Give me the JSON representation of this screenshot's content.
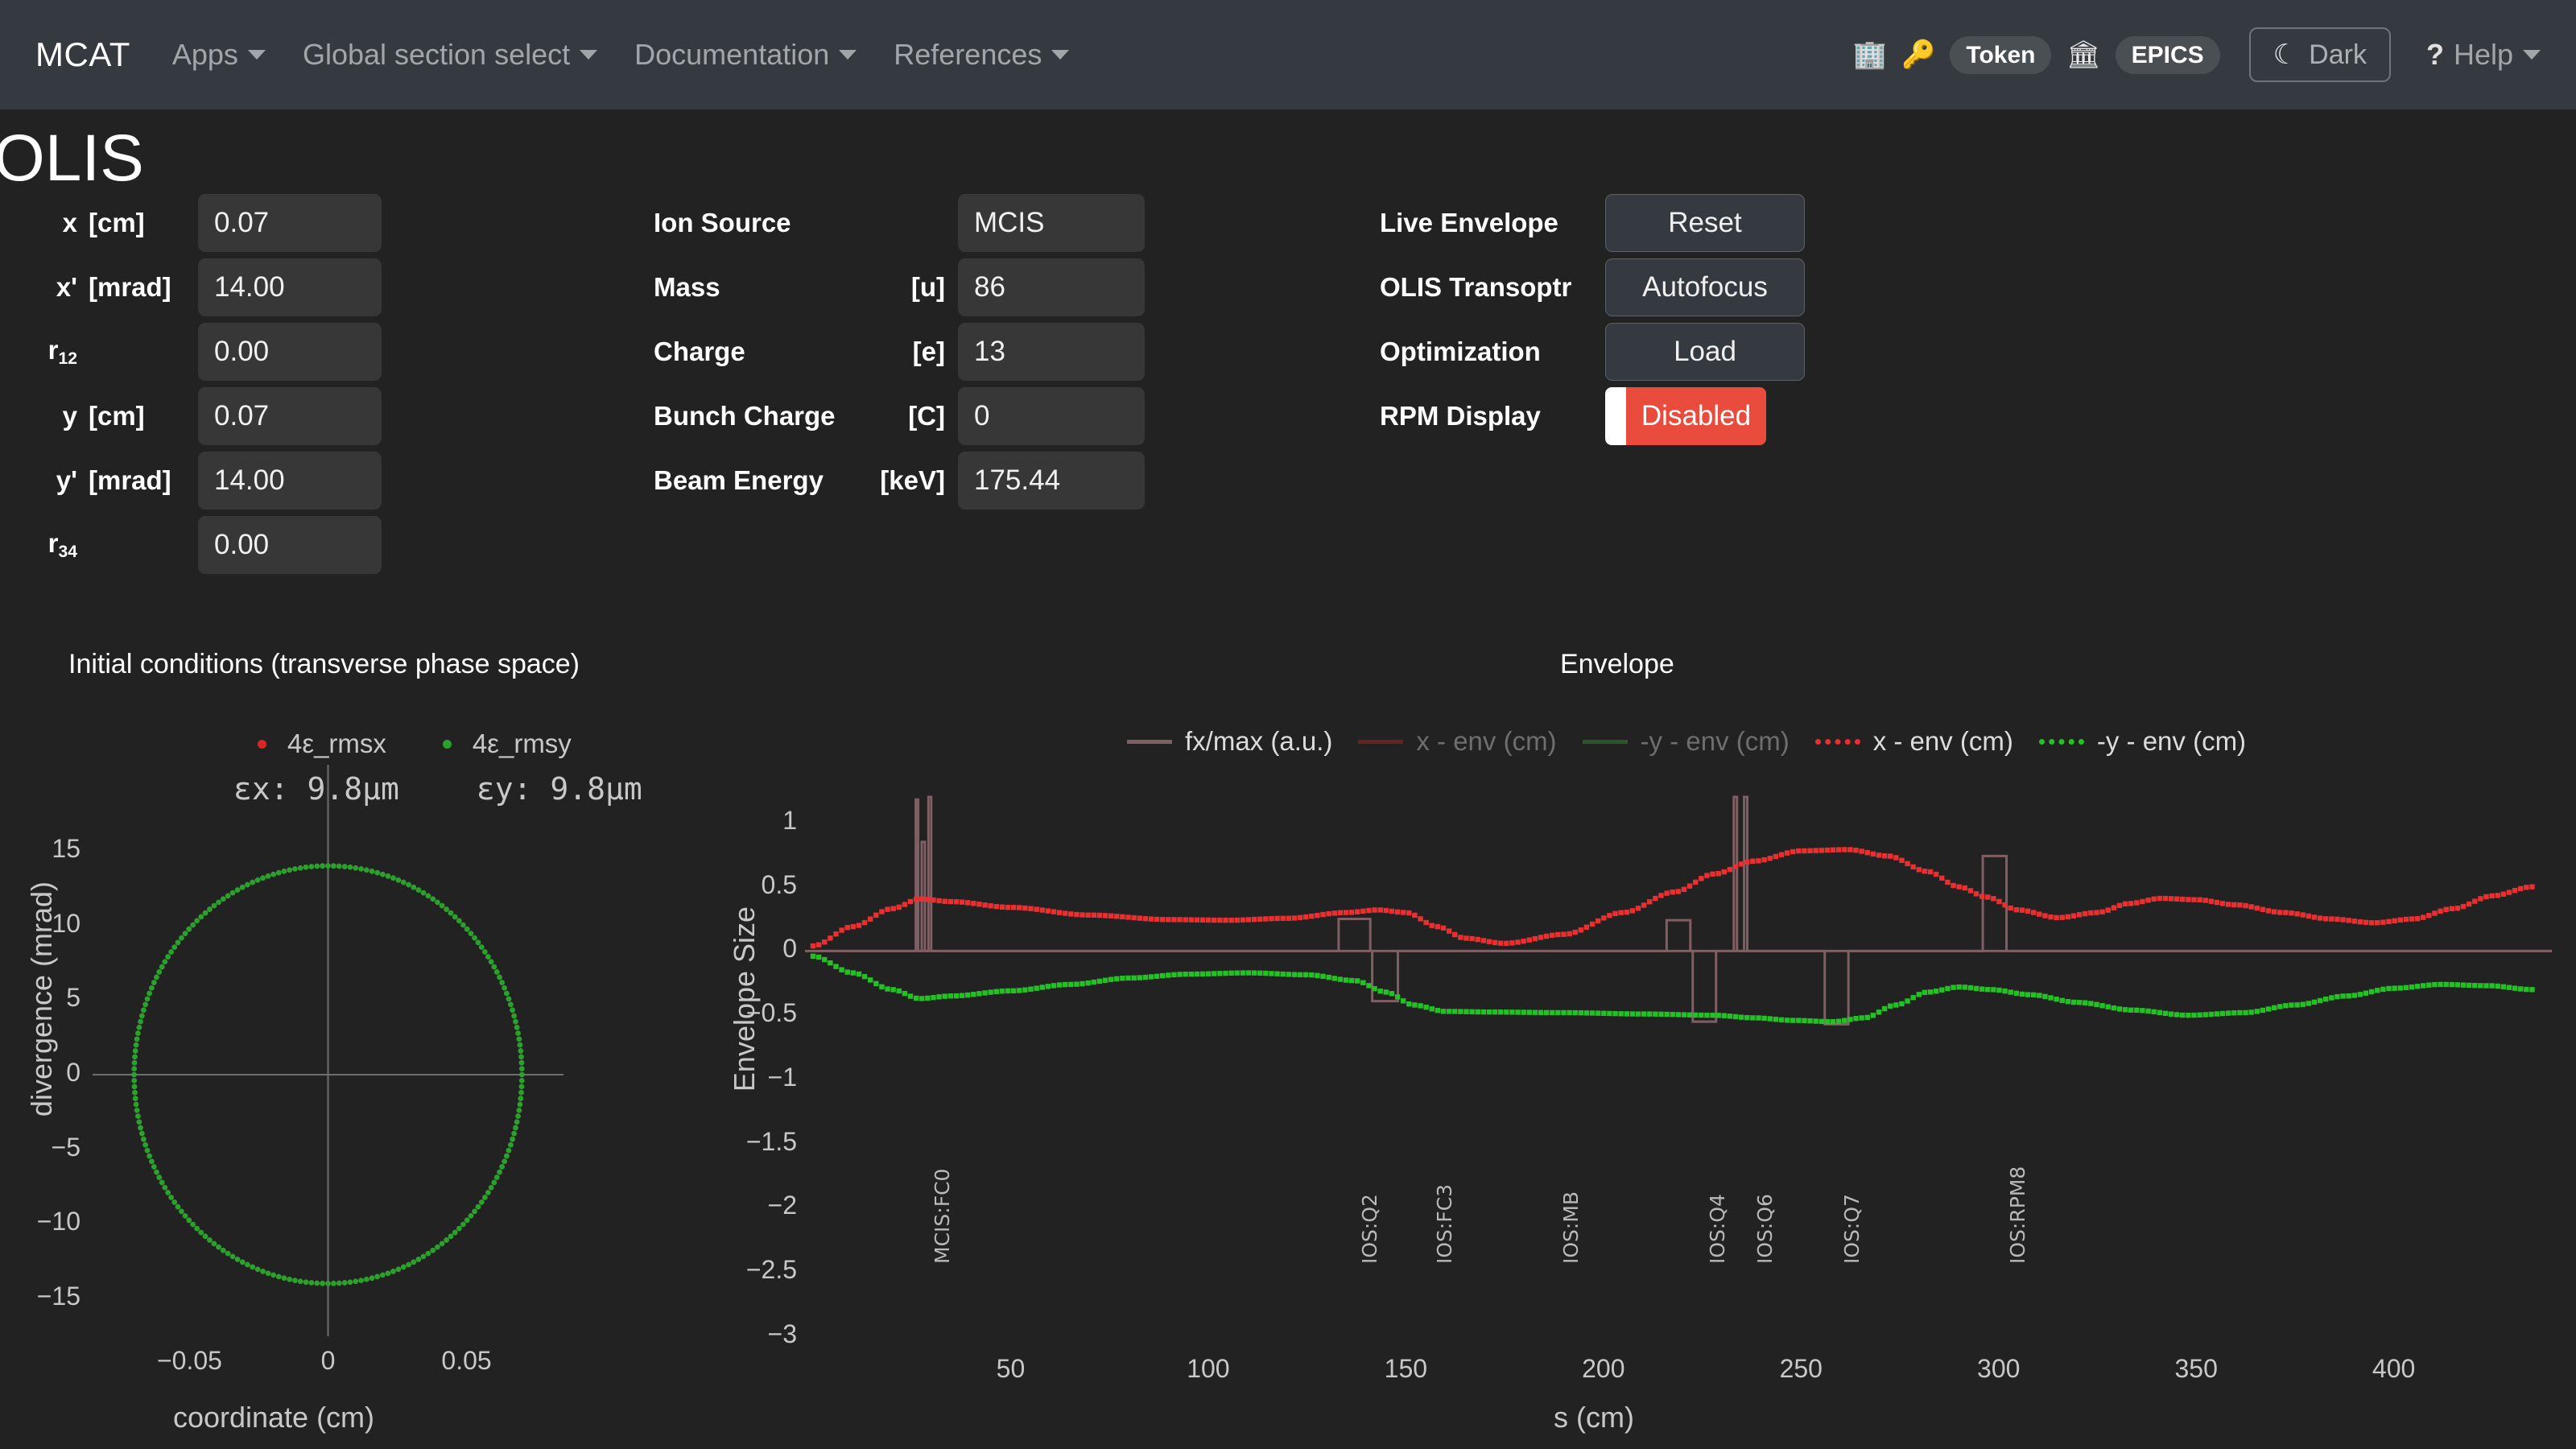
{
  "navbar": {
    "brand": "MCAT",
    "items": [
      {
        "label": "Apps"
      },
      {
        "label": "Global section select"
      },
      {
        "label": "Documentation"
      },
      {
        "label": "References"
      }
    ],
    "right": {
      "building_icon": "building-icon",
      "key_icon": "key-icon",
      "token_label": "Token",
      "epics_icon": "epics-icon",
      "epics_label": "EPICS",
      "theme_label": "Dark",
      "moon_icon": "moon-icon",
      "help_label": "Help",
      "question_icon": "question-mark-icon"
    }
  },
  "page": {
    "title": "OLIS"
  },
  "initial_conditions": {
    "fields": [
      {
        "label": "x",
        "sub": "",
        "unit": "[cm]",
        "value": "0.07"
      },
      {
        "label": "x'",
        "sub": "",
        "unit": "[mrad]",
        "value": "14.00"
      },
      {
        "label": "r",
        "sub": "12",
        "unit": "",
        "value": "0.00"
      },
      {
        "label": "y",
        "sub": "",
        "unit": "[cm]",
        "value": "0.07"
      },
      {
        "label": "y'",
        "sub": "",
        "unit": "[mrad]",
        "value": "14.00"
      },
      {
        "label": "r",
        "sub": "34",
        "unit": "",
        "value": "0.00"
      }
    ]
  },
  "beam": {
    "fields": [
      {
        "label": "Ion Source",
        "unit": "",
        "value": "MCIS"
      },
      {
        "label": "Mass",
        "unit": "[u]",
        "value": "86"
      },
      {
        "label": "Charge",
        "unit": "[e]",
        "value": "13"
      },
      {
        "label": "Bunch Charge",
        "unit": "[C]",
        "value": "0"
      },
      {
        "label": "Beam Energy",
        "unit": "[keV]",
        "value": "175.44"
      }
    ]
  },
  "controls": {
    "rows": [
      {
        "label": "Live Envelope",
        "action": "Reset"
      },
      {
        "label": "OLIS Transoptr",
        "action": "Autofocus"
      },
      {
        "label": "Optimization",
        "action": "Load"
      }
    ],
    "toggle": {
      "label": "RPM Display",
      "state": "Disabled",
      "color": "#e94b3c"
    }
  },
  "chart_data": [
    {
      "type": "scatter",
      "title": "Initial conditions (transverse phase space)",
      "xlabel": "coordinate (cm)",
      "ylabel": "divergence (mrad)",
      "xticks": [
        "−0.05",
        "0",
        "0.05"
      ],
      "yticks": [
        "15",
        "10",
        "5",
        "0",
        "−5",
        "−10",
        "−15"
      ],
      "xlim": [
        -0.085,
        0.085
      ],
      "ylim": [
        -17,
        17
      ],
      "grid": false,
      "legend_position": "top",
      "annotations": [
        {
          "text": "εx:  9.8μm"
        },
        {
          "text": "εy:  9.8μm"
        }
      ],
      "series": [
        {
          "name": "4ε_rmsx",
          "color": "#d62728",
          "visible": false,
          "ellipse": {
            "semi_x_cm": 0.07,
            "semi_y_mrad": 14.0
          }
        },
        {
          "name": "4ε_rmsy",
          "color": "#2ca02c",
          "visible": true,
          "ellipse": {
            "semi_x_cm": 0.07,
            "semi_y_mrad": 14.0
          }
        }
      ]
    },
    {
      "type": "line",
      "title": "Envelope",
      "xlabel": "s (cm)",
      "ylabel": "Envelope Size",
      "xticks": [
        "50",
        "100",
        "150",
        "200",
        "250",
        "300",
        "350",
        "400"
      ],
      "yticks": [
        "1",
        "0.5",
        "0",
        "−0.5",
        "−1",
        "−1.5",
        "−2",
        "−2.5",
        "−3"
      ],
      "xlim": [
        0,
        440
      ],
      "ylim": [
        -3,
        1.2
      ],
      "grid": false,
      "legend_position": "top",
      "legend": [
        {
          "name": "fx/max (a.u.)",
          "color": "#7f5f63",
          "style": "solid",
          "active": true
        },
        {
          "name": "x - env (cm)",
          "color": "#a02020",
          "style": "solid",
          "active": false
        },
        {
          "name": "-y - env (cm)",
          "color": "#2f7f2f",
          "style": "solid",
          "active": false
        },
        {
          "name": "x - env (cm)",
          "color": "#e83030",
          "style": "dotted",
          "active": true
        },
        {
          "name": "-y - env (cm)",
          "color": "#25c025",
          "style": "dotted",
          "active": true
        }
      ],
      "elements": [
        {
          "name": "MCIS:FC0",
          "s": 28
        },
        {
          "name": "IOS:Q2",
          "s": 136
        },
        {
          "name": "IOS:FC3",
          "s": 155
        },
        {
          "name": "IOS:MB",
          "s": 187
        },
        {
          "name": "IOS:Q4",
          "s": 224
        },
        {
          "name": "IOS:Q6",
          "s": 236
        },
        {
          "name": "IOS:Q7",
          "s": 258
        },
        {
          "name": "IOS:RPM8",
          "s": 300
        }
      ],
      "series": [
        {
          "name": "x - env (cm)",
          "color": "#e83030",
          "style": "dotted",
          "s": [
            0,
            10,
            20,
            27,
            35,
            50,
            70,
            90,
            105,
            120,
            135,
            143,
            150,
            158,
            165,
            175,
            190,
            205,
            218,
            228,
            238,
            250,
            262,
            272,
            282,
            290,
            297,
            305,
            315,
            325,
            333,
            341,
            350,
            360,
            372,
            384,
            395,
            405,
            415,
            425,
            435
          ],
          "y": [
            0.04,
            0.19,
            0.33,
            0.405,
            0.385,
            0.34,
            0.28,
            0.245,
            0.24,
            0.255,
            0.3,
            0.32,
            0.3,
            0.19,
            0.1,
            0.06,
            0.13,
            0.3,
            0.46,
            0.6,
            0.7,
            0.78,
            0.79,
            0.74,
            0.62,
            0.5,
            0.42,
            0.32,
            0.26,
            0.3,
            0.37,
            0.41,
            0.4,
            0.36,
            0.3,
            0.25,
            0.22,
            0.25,
            0.33,
            0.43,
            0.5
          ]
        },
        {
          "name": "-y - env (cm)",
          "color": "#25c025",
          "style": "dotted",
          "s": [
            0,
            10,
            20,
            27,
            35,
            50,
            65,
            80,
            95,
            110,
            125,
            137,
            145,
            152,
            160,
            172,
            190,
            210,
            228,
            238,
            248,
            258,
            266,
            274,
            282,
            290,
            298,
            308,
            320,
            334,
            348,
            362,
            375,
            388,
            400,
            412,
            424,
            435
          ],
          "y": [
            -0.04,
            -0.17,
            -0.3,
            -0.37,
            -0.35,
            -0.31,
            -0.26,
            -0.21,
            -0.18,
            -0.17,
            -0.185,
            -0.23,
            -0.32,
            -0.42,
            -0.47,
            -0.475,
            -0.48,
            -0.49,
            -0.5,
            -0.52,
            -0.54,
            -0.55,
            -0.52,
            -0.42,
            -0.32,
            -0.28,
            -0.3,
            -0.34,
            -0.4,
            -0.46,
            -0.5,
            -0.48,
            -0.42,
            -0.35,
            -0.29,
            -0.26,
            -0.27,
            -0.3
          ]
        }
      ],
      "lattice_color": "#7f5f63"
    }
  ]
}
